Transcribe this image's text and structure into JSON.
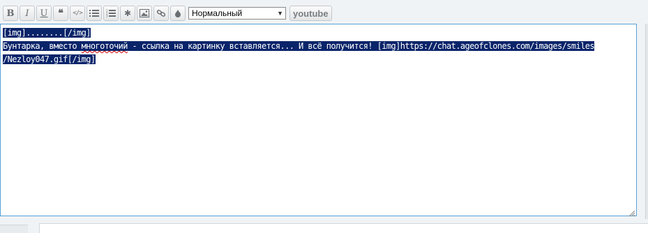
{
  "toolbar": {
    "buttons": [
      {
        "name": "bold-button",
        "icon": "bold-icon",
        "glyph": "B"
      },
      {
        "name": "italic-button",
        "icon": "italic-icon",
        "glyph": "I"
      },
      {
        "name": "underline-button",
        "icon": "underline-icon",
        "glyph": "U"
      },
      {
        "name": "quote-button",
        "icon": "quote-icon",
        "glyph": "❝"
      },
      {
        "name": "code-button",
        "icon": "code-icon",
        "glyph": "</>"
      },
      {
        "name": "bullet-list-button",
        "icon": "bullet-list-icon"
      },
      {
        "name": "numbered-list-button",
        "icon": "numbered-list-icon"
      },
      {
        "name": "list-item-button",
        "icon": "asterisk-icon",
        "glyph": "✱"
      },
      {
        "name": "image-button",
        "icon": "image-icon"
      },
      {
        "name": "link-button",
        "icon": "link-icon"
      },
      {
        "name": "color-button",
        "icon": "drop-icon"
      }
    ],
    "font_size_select": {
      "selected": "Нормальный",
      "arrow_icon": "chevron-down-icon"
    },
    "youtube_label": "youtube"
  },
  "editor": {
    "segments": {
      "s1": "[img]........[/img]",
      "s2": "Бунтарка, вместо ",
      "s3": "многоточий",
      "s4": " - ссылка на картинку вставляется... И всё получится! [img]https://chat.ageofclones.com/images/smiles",
      "s5": "/Nezloy047.gif[/img]"
    }
  },
  "colors": {
    "selection": "#0a246a",
    "editor_border": "#57a0d6",
    "spellcheck": "#d00000"
  }
}
